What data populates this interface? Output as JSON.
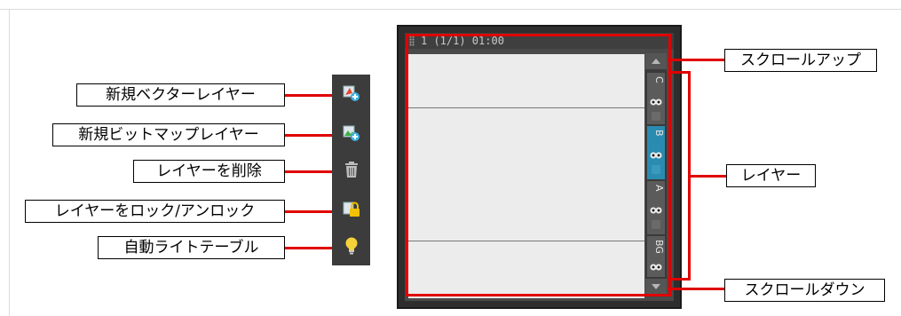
{
  "toolbar": {
    "buttons": [
      {
        "label": "新規ベクターレイヤー",
        "icon": "new-vector-layer-icon"
      },
      {
        "label": "新規ビットマップレイヤー",
        "icon": "new-bitmap-layer-icon"
      },
      {
        "label": "レイヤーを削除",
        "icon": "trash-icon"
      },
      {
        "label": "レイヤーをロック/アンロック",
        "icon": "lock-unlock-icon"
      },
      {
        "label": "自動ライトテーブル",
        "icon": "lightbulb-icon"
      }
    ]
  },
  "timeline": {
    "frame_label": "1 (1/1) 01:00",
    "layers": [
      {
        "name": "C",
        "active": false
      },
      {
        "name": "B",
        "active": true
      },
      {
        "name": "A",
        "active": false
      },
      {
        "name": "BG",
        "active": false
      }
    ]
  },
  "callouts": {
    "scroll_up": "スクロールアップ",
    "layers": "レイヤー",
    "scroll_down": "スクロールダウン"
  },
  "colors": {
    "highlight_red": "#e00000",
    "active_layer": "#2a8bb0",
    "panel_dark": "#2e2e2e"
  }
}
